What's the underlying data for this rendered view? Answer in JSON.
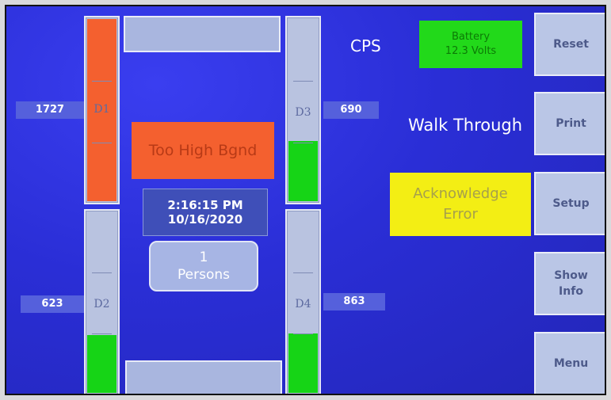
{
  "detectors": {
    "d1": {
      "label": "D1",
      "value": "1727",
      "level": 1.0,
      "status_color": "#f4602f"
    },
    "d2": {
      "label": "D2",
      "value": "623",
      "level": 0.33,
      "status_color": "#16d416"
    },
    "d3": {
      "label": "D3",
      "value": "690",
      "level": 0.34,
      "status_color": "#16d416"
    },
    "d4": {
      "label": "D4",
      "value": "863",
      "level": 0.34,
      "status_color": "#16d416"
    }
  },
  "center": {
    "alarm": "Too High Bgnd",
    "time": "2:16:15 PM",
    "date": "10/16/2020",
    "persons_count": "1",
    "persons_label": "Persons"
  },
  "status": {
    "cps_label": "CPS",
    "battery_line1": "Battery",
    "battery_line2": "12.3 Volts",
    "mode": "Walk Through",
    "ack_line1": "Acknowledge",
    "ack_line2": "Error"
  },
  "buttons": {
    "reset": "Reset",
    "print": "Print",
    "setup": "Setup",
    "show_line1": "Show",
    "show_line2": "Info",
    "menu": "Menu"
  },
  "colors": {
    "background": "#2c2fd8",
    "alarm": "#f4602f",
    "ok": "#16d416",
    "warning": "#f3ee14",
    "battery": "#22d91a"
  }
}
